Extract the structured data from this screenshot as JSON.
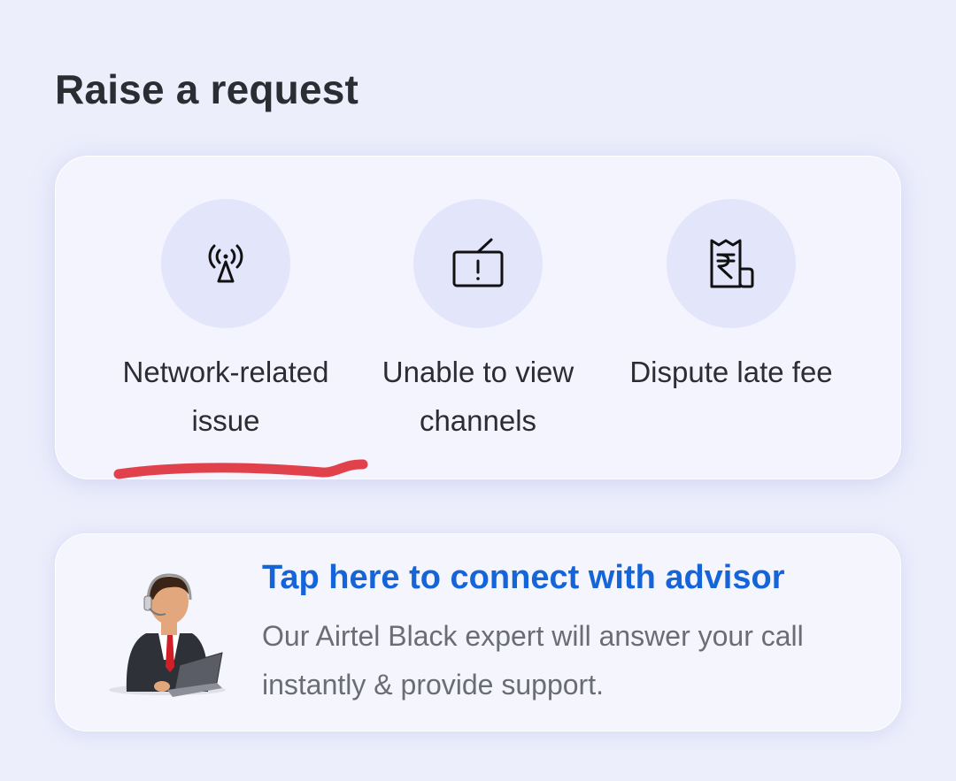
{
  "page": {
    "title": "Raise a request"
  },
  "request_options": [
    {
      "label": "Network-related issue",
      "icon": "network-tower-icon"
    },
    {
      "label": "Unable to view channels",
      "icon": "tv-alert-icon"
    },
    {
      "label": "Dispute late fee",
      "icon": "rupee-receipt-icon"
    }
  ],
  "advisor": {
    "title": "Tap here to connect with advisor",
    "description": "Our Airtel Black expert will answer your call instantly & provide support.",
    "illustration": "support-agent-illustration"
  },
  "colors": {
    "background": "#eceefc",
    "card": "#f3f4fd",
    "icon_circle": "#e3e5fb",
    "accent_link": "#1565d8",
    "annotation_red": "#e0414a"
  }
}
